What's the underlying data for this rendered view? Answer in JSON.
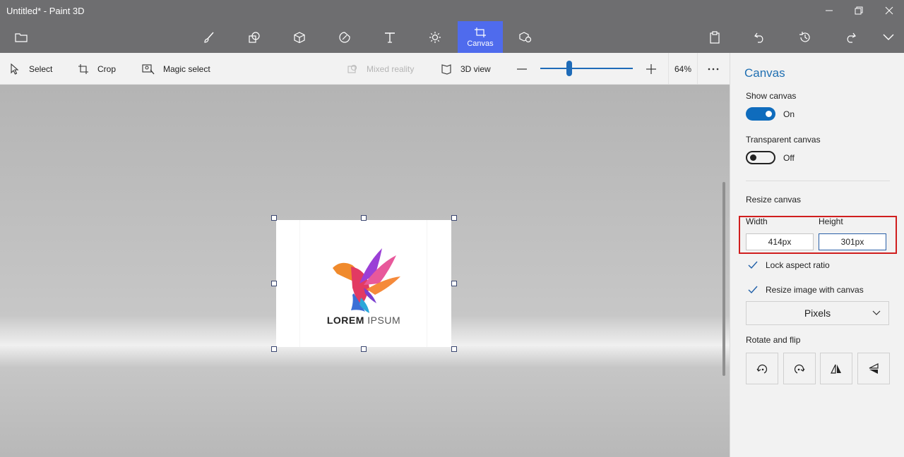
{
  "window": {
    "title": "Untitled* - Paint 3D"
  },
  "toolbar": {
    "canvas_label": "Canvas"
  },
  "subbar": {
    "select_label": "Select",
    "crop_label": "Crop",
    "magic_select_label": "Magic select",
    "mixed_reality_label": "Mixed reality",
    "view3d_label": "3D view",
    "zoom_level": "64%"
  },
  "canvas_image": {
    "logo_bold": "LOREM",
    "logo_light": " IPSUM"
  },
  "panel": {
    "title": "Canvas",
    "show_canvas_label": "Show canvas",
    "show_canvas_state": "On",
    "transparent_label": "Transparent canvas",
    "transparent_state": "Off",
    "resize_label": "Resize canvas",
    "width_label": "Width",
    "height_label": "Height",
    "width_value": "414px",
    "height_value": "301px",
    "lock_aspect_label": "Lock aspect ratio",
    "resize_image_label": "Resize image with canvas",
    "units_selected": "Pixels",
    "rotate_label": "Rotate and flip"
  },
  "colors": {
    "accent": "#0f6cbd",
    "active_tool": "#4f6bed",
    "highlight": "#d01e1e",
    "chrome": "#6e6e70"
  }
}
